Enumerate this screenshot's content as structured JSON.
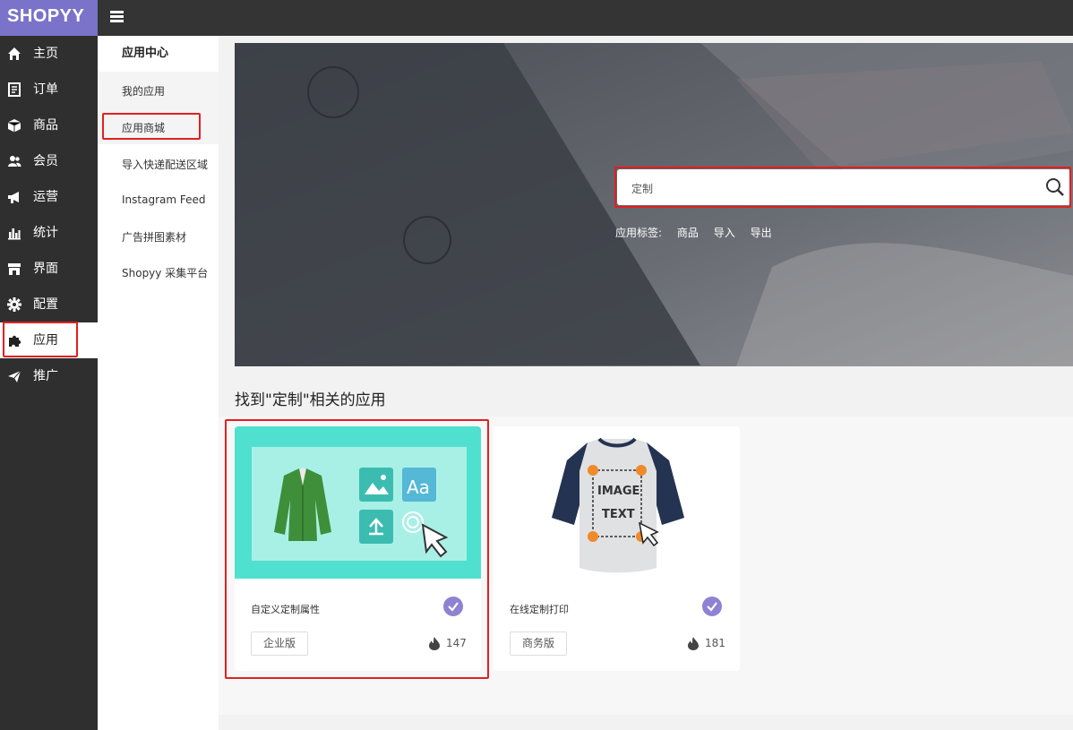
{
  "brand": {
    "logo": "SHOPYY"
  },
  "sidebar": {
    "items": [
      {
        "icon": "home-icon",
        "label": "主页"
      },
      {
        "icon": "order-icon",
        "label": "订单"
      },
      {
        "icon": "product-box-icon",
        "label": "商品"
      },
      {
        "icon": "members-icon",
        "label": "会员"
      },
      {
        "icon": "megaphone-icon",
        "label": "运营"
      },
      {
        "icon": "bar-chart-icon",
        "label": "统计"
      },
      {
        "icon": "storefront-icon",
        "label": "界面"
      },
      {
        "icon": "gear-icon",
        "label": "配置"
      },
      {
        "icon": "puzzle-icon",
        "label": "应用"
      },
      {
        "icon": "paper-plane-icon",
        "label": "推广"
      }
    ],
    "active_index": 8
  },
  "subnav": {
    "title": "应用中心",
    "items": [
      "我的应用",
      "应用商城",
      "导入快递配送区域",
      "Instagram Feed",
      "广告拼图素材",
      "Shopyy 采集平台"
    ],
    "active_index": 1
  },
  "banner": {
    "search": {
      "value": "定制",
      "icon": "search-icon"
    },
    "tags_label": "应用标签:",
    "tags": [
      "商品",
      "导入",
      "导出"
    ]
  },
  "results": {
    "title": "找到\"定制\"相关的应用",
    "apps": [
      {
        "name": "自定义定制属性",
        "edition": "企业版",
        "count": "147",
        "verified": true
      },
      {
        "name": "在线定制打印",
        "edition": "商务版",
        "count": "181",
        "verified": true
      }
    ]
  },
  "illustration_text": {
    "line1": "IMAGE",
    "line2": "TEXT"
  },
  "colors": {
    "brand": "#7a73c9",
    "sidebar": "#2f2f2f",
    "topbar": "#343434",
    "highlight": "#e02020",
    "card_teal": "#4fe0cf",
    "verified": "#8f82d2"
  }
}
